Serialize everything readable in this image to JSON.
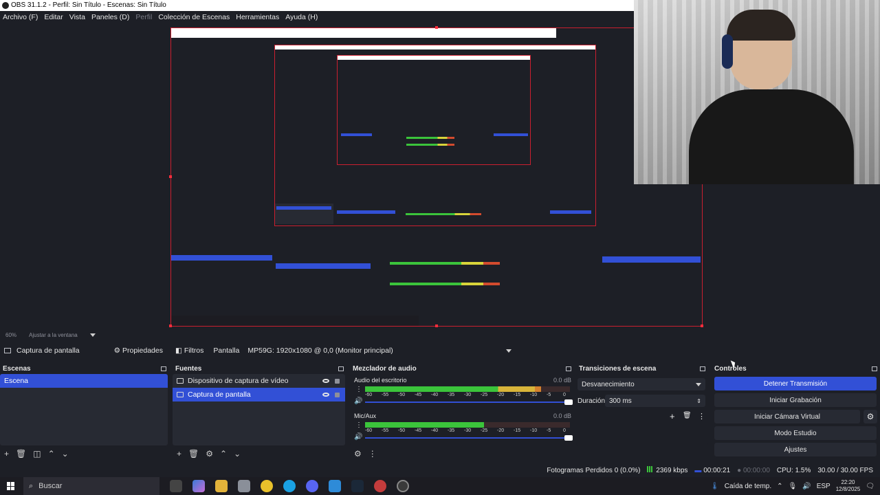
{
  "window": {
    "title": "OBS 31.1.2 - Perfil: Sin Título - Escenas: Sin Título"
  },
  "menu": [
    {
      "label": "Archivo (F)"
    },
    {
      "label": "Editar"
    },
    {
      "label": "Vista"
    },
    {
      "label": "Paneles (D)"
    },
    {
      "label": "Perfil"
    },
    {
      "label": "Colección de Escenas"
    },
    {
      "label": "Herramientas"
    },
    {
      "label": "Ayuda (H)"
    }
  ],
  "preview": {
    "zoom": "60%",
    "fit_label": "Ajustar a la ventana"
  },
  "source_toolbar": {
    "selected_source": "Captura de pantalla",
    "properties_label": "Propiedades",
    "filters_label": "Filtros",
    "display_label": "Pantalla",
    "display_value": "MP59G: 1920x1080 @ 0,0 (Monitor principal)"
  },
  "docks": {
    "scenes": {
      "title": "Escenas",
      "items": [
        "Escena"
      ]
    },
    "sources": {
      "title": "Fuentes",
      "items": [
        "Dispositivo de captura de vídeo",
        "Captura de pantalla"
      ]
    },
    "mixer": {
      "title": "Mezclador de audio",
      "channels": [
        {
          "name": "Audio del escritorio",
          "db": "0.0 dB",
          "level": 0.86
        },
        {
          "name": "Mic/Aux",
          "db": "0.0 dB",
          "level": 0.58
        }
      ],
      "scale": [
        "-60",
        "-55",
        "-50",
        "-45",
        "-40",
        "-35",
        "-30",
        "-25",
        "-20",
        "-15",
        "-10",
        "-5",
        "0"
      ]
    },
    "transitions": {
      "title": "Transiciones de escena",
      "selected": "Desvanecimiento",
      "duration_label": "Duración",
      "duration_value": "300 ms"
    },
    "controls": {
      "title": "Controles",
      "buttons": [
        "Detener Transmisión",
        "Iniciar Grabación",
        "Iniciar Cámara Virtual",
        "Modo Estudio",
        "Ajustes"
      ]
    }
  },
  "status": {
    "dropped": "Fotogramas Perdidos 0 (0.0%)",
    "bitrate": "2369 kbps",
    "stream_time": "00:00:21",
    "rec_time": "00:00:00",
    "cpu": "CPU: 1.5%",
    "fps": "30.00 / 30.00 FPS"
  },
  "taskbar": {
    "search_label": "Buscar",
    "weather": "Caída de temp.",
    "lang": "ESP",
    "time": "22:20",
    "date": "12/8/2025"
  },
  "colors": {
    "accent": "#3250d6",
    "dock_bg": "#272a33",
    "window_bg": "#1d1f26",
    "selection_border": "#cc1f2f"
  }
}
